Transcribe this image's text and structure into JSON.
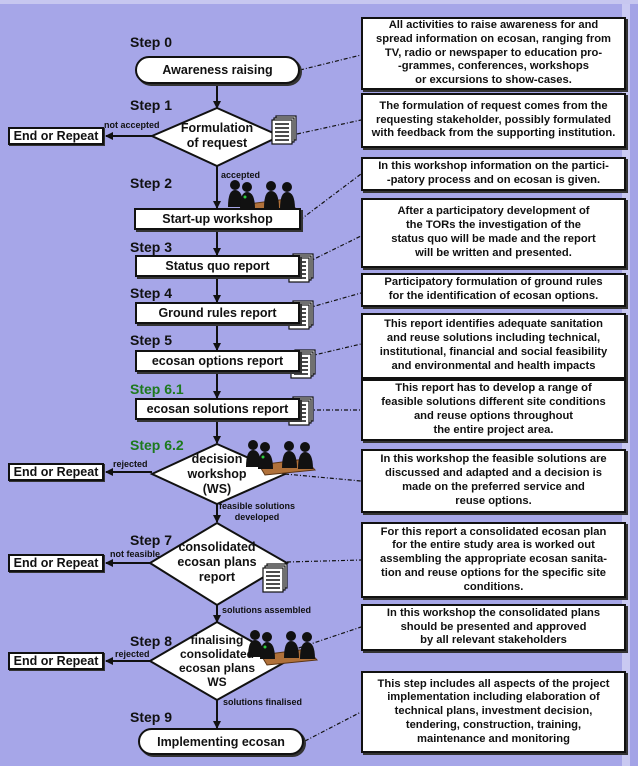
{
  "diagram": {
    "steps": [
      {
        "id": "step0",
        "label": "Step 0",
        "node": "Awareness raising",
        "shape": "pill",
        "description": "All activities to raise awareness for and\nspread information on ecosan, ranging from\nTV, radio or newspaper to education pro-\n-grammes, conferences, workshops\nor excursions to show-cases."
      },
      {
        "id": "step1",
        "label": "Step 1",
        "node": "Formulation\nof request",
        "shape": "diamond",
        "icon": "document-icon",
        "description": "The formulation of request comes from the\nrequesting stakeholder, possibly formulated\nwith feedback from the supporting institution."
      },
      {
        "id": "step2",
        "label": "Step 2",
        "node": "Start-up workshop",
        "shape": "rect",
        "icon": "meeting-icon",
        "description": "In this workshop information on the partici-\n-patory process and on ecosan is given."
      },
      {
        "id": "step3",
        "label": "Step 3",
        "node": "Status quo report",
        "shape": "rect",
        "icon": "document-icon",
        "description": "After a participatory development of\nthe TORs the investigation of the\nstatus quo will be made and the report\nwill be written and presented."
      },
      {
        "id": "step4",
        "label": "Step 4",
        "node": "Ground rules report",
        "shape": "rect",
        "icon": "document-icon",
        "description": "Participatory formulation of ground rules\nfor the identification of ecosan options."
      },
      {
        "id": "step5",
        "label": "Step 5",
        "node": "ecosan options report",
        "shape": "rect",
        "icon": "document-icon",
        "description": "This report identifies adequate sanitation\nand reuse solutions including technical,\ninstitutional, financial and social feasibility\nand environmental and health impacts"
      },
      {
        "id": "step61",
        "label": "Step 6.1",
        "node": "ecosan solutions report",
        "shape": "rect",
        "icon": "document-icon",
        "label_color": "#1d7a1d",
        "description": "This report has to develop a range of\nfeasible solutions different site conditions\nand reuse options throughout\nthe entire project area."
      },
      {
        "id": "step62",
        "label": "Step 6.2",
        "node": "decision\nworkshop\n(WS)",
        "shape": "diamond",
        "icon": "meeting-icon",
        "label_color": "#1d7a1d",
        "description": "In this workshop the feasible solutions are\ndiscussed and adapted and a decision is\nmade on the preferred service and\nreuse options."
      },
      {
        "id": "step7",
        "label": "Step 7",
        "node": "consolidated\necosan plans\nreport",
        "shape": "diamond",
        "icon": "document-icon",
        "description": "For this report a consolidated ecosan plan\nfor the entire study area is worked out\nassembling the appropriate ecosan sanita-\ntion and reuse options for the specific site\nconditions."
      },
      {
        "id": "step8",
        "label": "Step 8",
        "node": "finalising\nconsolidated\necosan plans\nWS",
        "shape": "diamond",
        "icon": "meeting-icon",
        "description": "In this workshop the consolidated plans\nshould be presented and approved\nby all relevant stakeholders"
      },
      {
        "id": "step9",
        "label": "Step 9",
        "node": "Implementing ecosan",
        "shape": "pill",
        "description": "This step includes all aspects of the project\nimplementation including elaboration of\ntechnical plans, investment decision,\ntendering, construction, training,\nmaintenance and monitoring"
      }
    ],
    "end_boxes": [
      {
        "label": "End or Repeat",
        "from": "step1",
        "edge_label": "not accepted"
      },
      {
        "label": "End or Repeat",
        "from": "step62",
        "edge_label": "rejected"
      },
      {
        "label": "End or Repeat",
        "from": "step7",
        "edge_label": "not feasible"
      },
      {
        "label": "End or Repeat",
        "from": "step8",
        "edge_label": "rejected"
      }
    ],
    "flow_labels": {
      "step1_to_step2": "accepted",
      "step62_to_step7": "feasible solutions\ndeveloped",
      "step7_to_step8": "solutions assembled",
      "step8_to_step9": "solutions finalised"
    },
    "colors": {
      "background": "#a6a6e8",
      "node_fill": "#ffffff",
      "stroke": "#111111",
      "green_step": "#1d7a1d"
    }
  }
}
